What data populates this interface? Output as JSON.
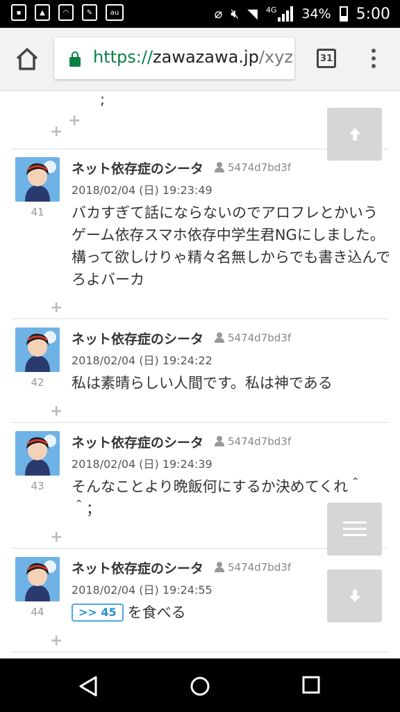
{
  "status_bar": {
    "battery_text": "34%",
    "time": "5:00",
    "network_label": "4G",
    "left_icons": [
      "contacts-icon",
      "image-icon",
      "wifi-file-icon",
      "edit-icon",
      "au-icon"
    ],
    "right_icons": [
      "no-sim-icon",
      "mute-icon",
      "wifi-icon",
      "signal-icon",
      "battery-icon"
    ]
  },
  "browser": {
    "url_protocol": "https://",
    "url_host": "zawazawa.jp",
    "url_path": "/xyz",
    "tab_count": "31"
  },
  "thread": {
    "prev_tail": ";",
    "posts": [
      {
        "number": "41",
        "name": "ネット依存症のシータ",
        "user_id": "5474d7bd3f",
        "date": "2018/02/04 (日) 19:23:49",
        "body": "バカすぎて話にならないのでアロフレとかいうゲーム依存スマホ依存中学生君NGにしました。構って欲しけりゃ精々名無しからでも書き込んでろよバーカ"
      },
      {
        "number": "42",
        "name": "ネット依存症のシータ",
        "user_id": "5474d7bd3f",
        "date": "2018/02/04 (日) 19:24:22",
        "body": "私は素晴らしい人間です。私は神である"
      },
      {
        "number": "43",
        "name": "ネット依存症のシータ",
        "user_id": "5474d7bd3f",
        "date": "2018/02/04 (日) 19:24:39",
        "body": "そんなことより晩飯何にするか決めてくれ＾＾；"
      },
      {
        "number": "44",
        "name": "ネット依存症のシータ",
        "user_id": "5474d7bd3f",
        "date": "2018/02/04 (日) 19:24:55",
        "anchor": ">> 45",
        "body": "を食べる"
      }
    ],
    "plus_glyph": "+"
  },
  "colors": {
    "accent_green": "#0b8043",
    "anchor_blue": "#2a8fd0",
    "fab_gray": "#d6d6d6"
  }
}
